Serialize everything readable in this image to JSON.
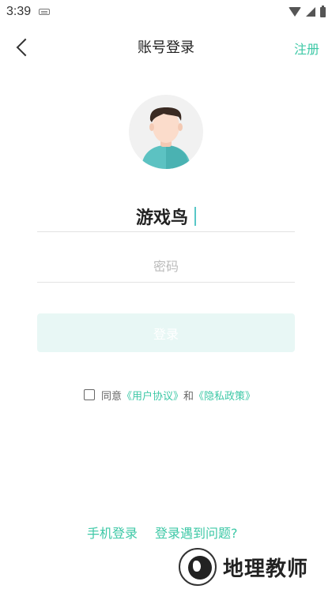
{
  "status_bar": {
    "time": "3:39",
    "icons": [
      "keyboard-icon",
      "wifi-icon",
      "signal-icon",
      "battery-icon"
    ]
  },
  "nav": {
    "back_icon": "back-chevron-icon",
    "title": "账号登录",
    "register_label": "注册"
  },
  "avatar": {
    "icon": "avatar-icon"
  },
  "form": {
    "username_value": "游戏鸟",
    "password_placeholder": "密码",
    "login_label": "登录"
  },
  "agreement": {
    "prefix": "同意",
    "user_agreement": "《用户协议》",
    "conjunction": "和",
    "privacy_policy": "《隐私政策》"
  },
  "bottom_links": {
    "phone_login": "手机登录",
    "login_problem": "登录遇到问题?"
  },
  "watermark": {
    "text": "地理教师"
  },
  "colors": {
    "accent": "#3dc8a6",
    "button_bg_disabled": "#e8f7f5",
    "divider": "#e3e3e3",
    "placeholder": "#bbbbbb"
  }
}
